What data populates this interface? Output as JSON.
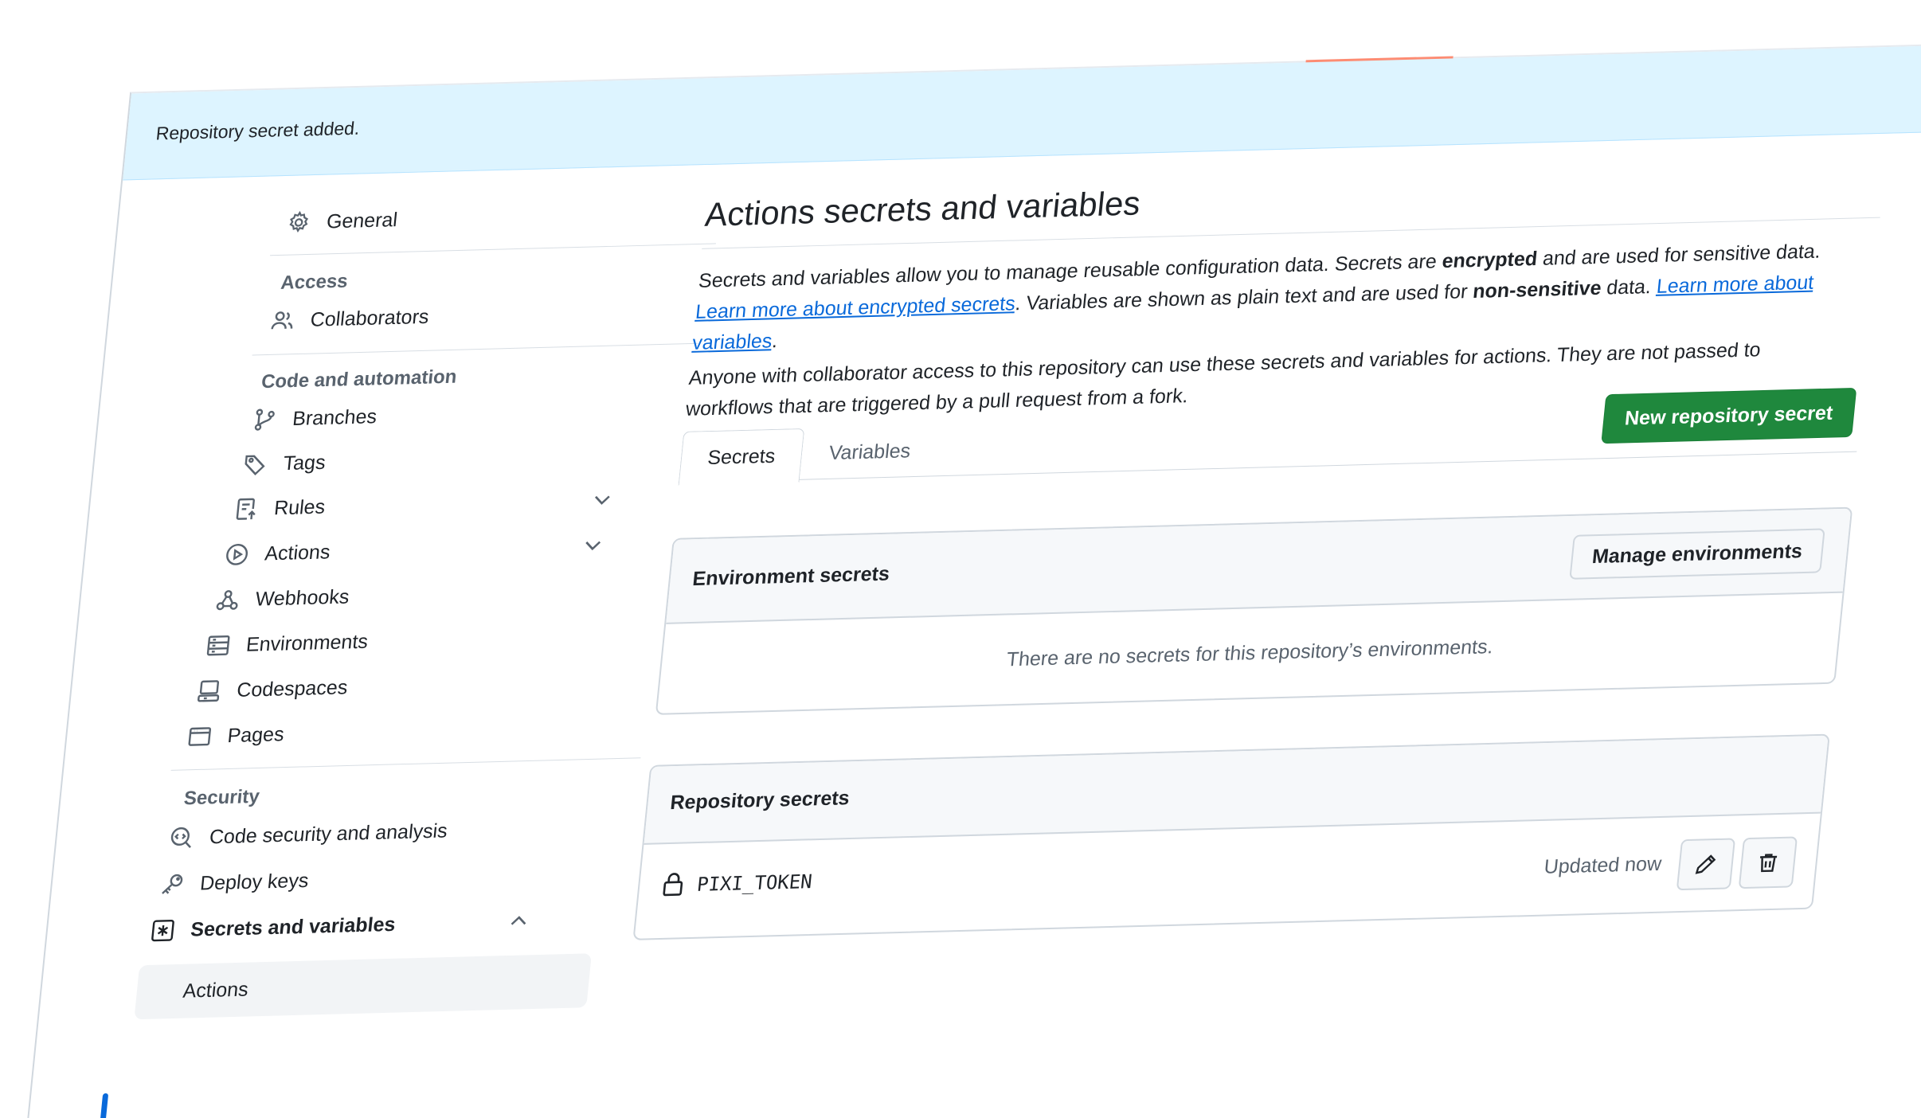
{
  "flash": {
    "message": "Repository secret added."
  },
  "sidebar": {
    "general": "General",
    "groups": {
      "access": "Access",
      "code_automation": "Code and automation",
      "security": "Security"
    },
    "items": {
      "collaborators": "Collaborators",
      "branches": "Branches",
      "tags": "Tags",
      "rules": "Rules",
      "actions": "Actions",
      "webhooks": "Webhooks",
      "environments": "Environments",
      "codespaces": "Codespaces",
      "pages": "Pages",
      "code_security": "Code security and analysis",
      "deploy_keys": "Deploy keys",
      "secrets_variables": "Secrets and variables",
      "secrets_actions": "Actions"
    }
  },
  "main": {
    "title": "Actions secrets and variables",
    "desc": {
      "p1_a": "Secrets and variables allow you to manage reusable configuration data. Secrets are ",
      "p1_b": "encrypted",
      "p1_c": " and are used for sensitive data. ",
      "link_secrets": "Learn more about encrypted secrets",
      "p1_d": ". Variables are shown as plain text and are used for ",
      "p1_e": "non-sensitive",
      "p1_f": " data. ",
      "link_variables": "Learn more about variables",
      "p1_g": ".",
      "p2": "Anyone with collaborator access to this repository can use these secrets and variables for actions. They are not passed to workflows that are triggered by a pull request from a fork."
    },
    "tabs": {
      "secrets": "Secrets",
      "variables": "Variables"
    },
    "new_secret_button": "New repository secret",
    "environment_secrets": {
      "heading": "Environment secrets",
      "manage_button": "Manage environments",
      "empty": "There are no secrets for this repository’s environments."
    },
    "repository_secrets": {
      "heading": "Repository secrets",
      "rows": [
        {
          "name": "PIXI_TOKEN",
          "updated": "Updated now"
        }
      ]
    }
  },
  "colors": {
    "accent": "#0969da",
    "primary": "#1f883d",
    "flash_bg": "#ddf4ff"
  }
}
